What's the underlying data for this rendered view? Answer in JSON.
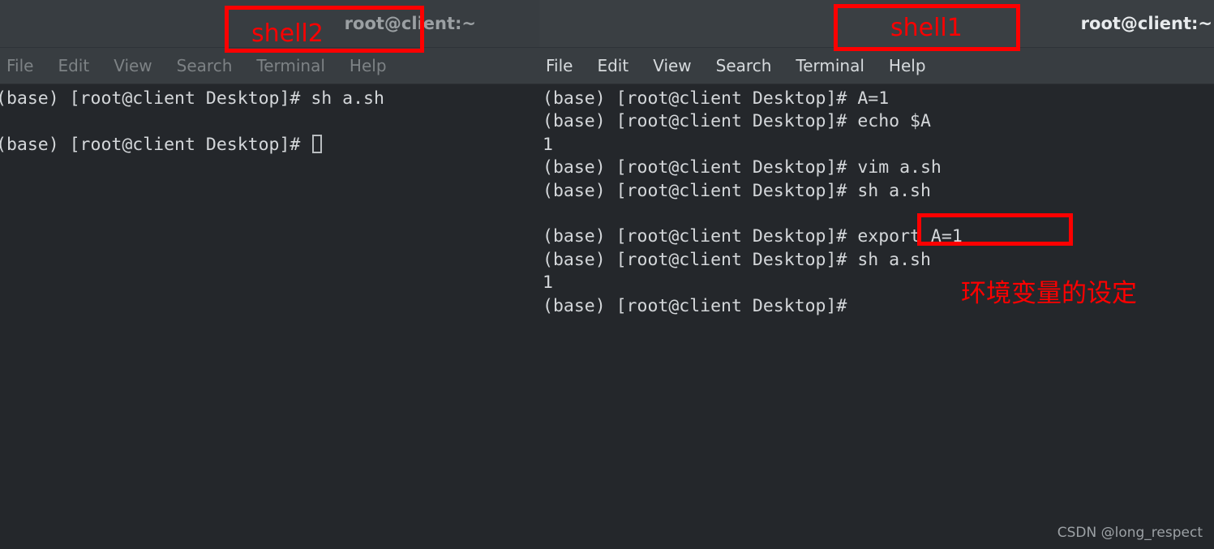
{
  "windows": {
    "left": {
      "name": "shell2",
      "title": "root@client:~",
      "active": false,
      "menu": [
        "File",
        "Edit",
        "View",
        "Search",
        "Terminal",
        "Help"
      ],
      "lines": [
        "(base) [root@client Desktop]# sh a.sh",
        "",
        "(base) [root@client Desktop]# "
      ],
      "cursor_on_last_line": true
    },
    "right": {
      "name": "shell1",
      "title": "root@client:~",
      "active": true,
      "menu": [
        "File",
        "Edit",
        "View",
        "Search",
        "Terminal",
        "Help"
      ],
      "lines": [
        "(base) [root@client Desktop]# A=1",
        "(base) [root@client Desktop]# echo $A",
        "1",
        "(base) [root@client Desktop]# vim a.sh",
        "(base) [root@client Desktop]# sh a.sh",
        "",
        "(base) [root@client Desktop]# export A=1",
        "(base) [root@client Desktop]# sh a.sh",
        "1",
        "(base) [root@client Desktop]# "
      ],
      "cursor_on_last_line": false
    }
  },
  "annotations": {
    "shell2_label": "shell2",
    "shell1_label": "shell1",
    "export_highlight": "export A=1",
    "chinese_note": "环境变量的设定",
    "color": "#fe0000"
  },
  "watermark": "CSDN @long_respect",
  "colors": {
    "terminal_bg": "#24272b",
    "titlebar_bg": "#393e42",
    "menubar_bg": "#383d41",
    "text": "#d4d7da",
    "menu_active": "#d6dadd",
    "menu_inactive": "#7d8285",
    "annotation_red": "#fe0000"
  }
}
